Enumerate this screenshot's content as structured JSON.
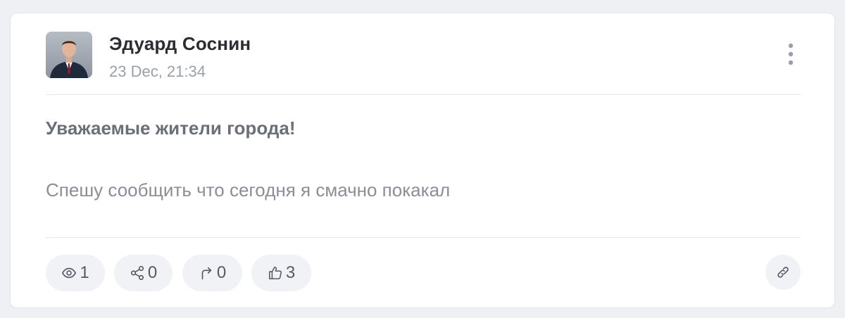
{
  "post": {
    "author": {
      "name": "Эдуард Соснин",
      "avatar_alt": "avatar"
    },
    "date": "23 Dec, 21:34",
    "headline": "Уважаемые жители города!",
    "text": "Спешу сообщить что сегодня я смачно покакал"
  },
  "actions": {
    "views": {
      "icon": "eye-icon",
      "count": "1"
    },
    "shares": {
      "icon": "share-icon",
      "count": "0"
    },
    "reposts": {
      "icon": "forward-arrow-icon",
      "count": "0"
    },
    "likes": {
      "icon": "thumbs-up-icon",
      "count": "3"
    },
    "link": {
      "icon": "link-icon"
    }
  },
  "colors": {
    "page_background": "#eef0f4",
    "card_background": "#ffffff",
    "pill_background": "#f1f2f6",
    "author_name": "#2b2d33",
    "muted_text": "#9aa0aa"
  }
}
